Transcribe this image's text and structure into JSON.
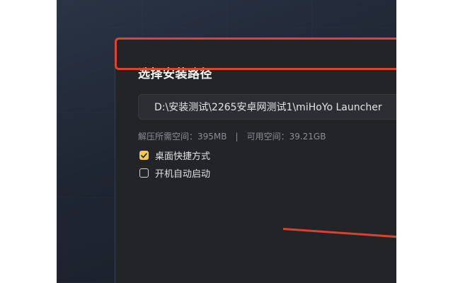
{
  "dialog": {
    "title": "选择安装路径",
    "install_path": "D:\\安装测试\\2265安卓网测试1\\miHoYo Launcher",
    "space": {
      "required_label": "解压所需空间：",
      "required_value": "395MB",
      "separator": "|",
      "available_label": "可用空间：",
      "available_value": "39.21GB"
    },
    "options": [
      {
        "label": "桌面快捷方式",
        "checked": true
      },
      {
        "label": "开机自动启动",
        "checked": false
      }
    ]
  },
  "colors": {
    "accent_checkbox": "#f2c94c",
    "annotation_red": "#e0432f",
    "dialog_bg": "#222428"
  }
}
